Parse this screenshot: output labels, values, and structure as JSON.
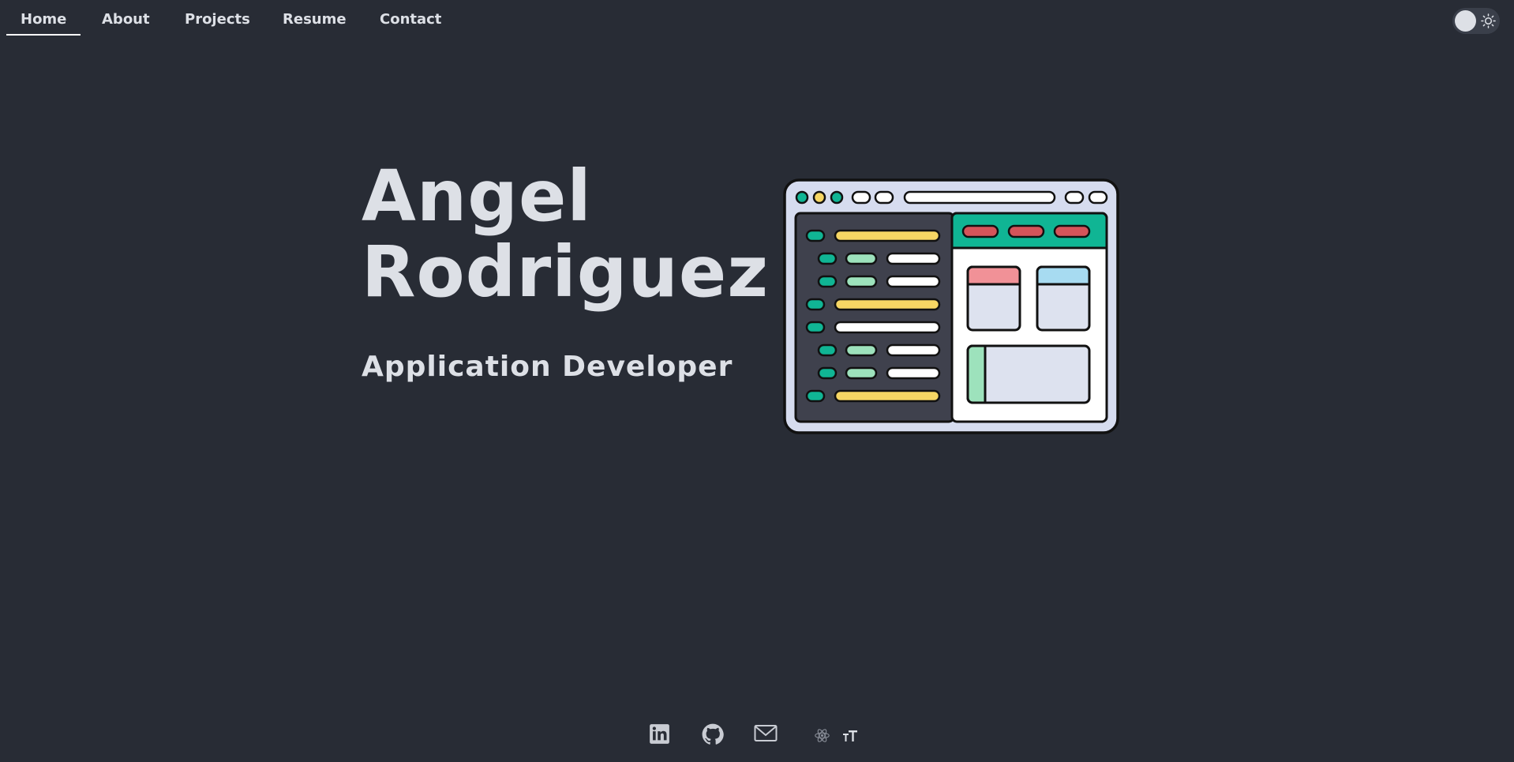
{
  "nav": {
    "items": [
      {
        "label": "Home",
        "active": true
      },
      {
        "label": "About",
        "active": false
      },
      {
        "label": "Projects",
        "active": false
      },
      {
        "label": "Resume",
        "active": false
      },
      {
        "label": "Contact",
        "active": false
      }
    ]
  },
  "theme_toggle": {
    "icon": "sun-icon",
    "state": "dark"
  },
  "hero": {
    "name_line1": "Angel",
    "name_line2": "Rodriguez",
    "role": "Application Developer"
  },
  "illustration": {
    "icon": "app-window-illustration"
  },
  "footer": {
    "icons": [
      "linkedin-icon",
      "github-icon",
      "mail-icon",
      "react-icon",
      "font-size-icon"
    ]
  },
  "colors": {
    "background": "#282c35",
    "text": "#dde0e6",
    "teal": "#10b594",
    "yellow": "#f6d664",
    "mint": "#9de2bc",
    "red": "#d4545a",
    "pink": "#f19197",
    "light_blue": "#a7dbf1"
  }
}
